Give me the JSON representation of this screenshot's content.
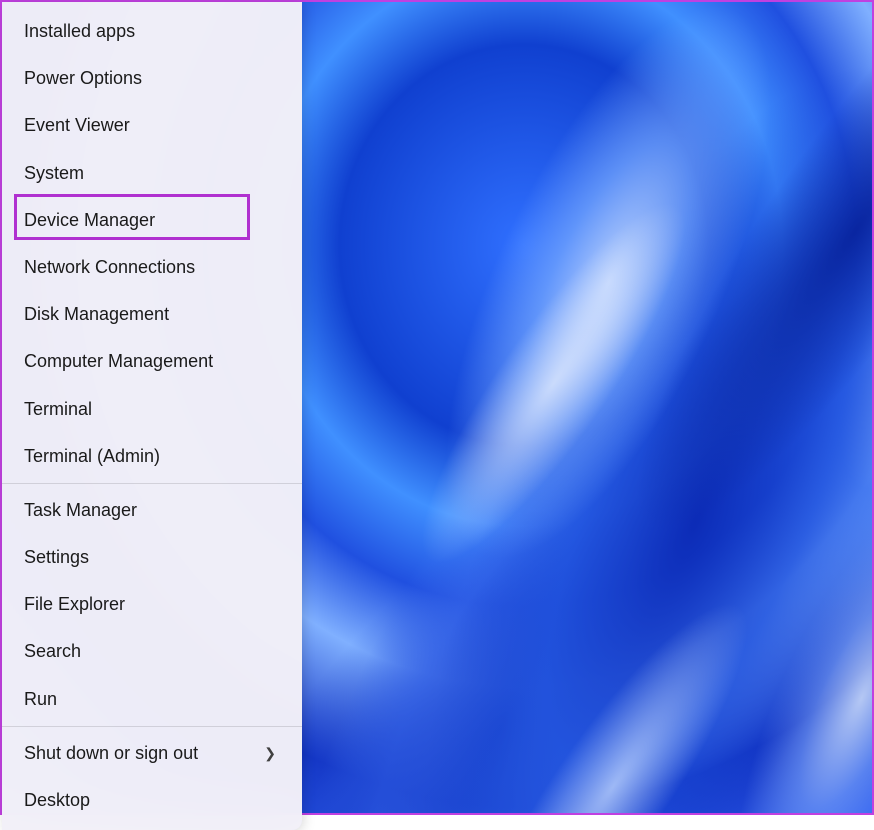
{
  "menu": {
    "groups": [
      {
        "items": [
          {
            "id": "installed-apps",
            "label": "Installed apps",
            "has_submenu": false
          },
          {
            "id": "power-options",
            "label": "Power Options",
            "has_submenu": false
          },
          {
            "id": "event-viewer",
            "label": "Event Viewer",
            "has_submenu": false
          },
          {
            "id": "system",
            "label": "System",
            "has_submenu": false
          },
          {
            "id": "device-manager",
            "label": "Device Manager",
            "has_submenu": false,
            "highlighted": true
          },
          {
            "id": "network-connections",
            "label": "Network Connections",
            "has_submenu": false
          },
          {
            "id": "disk-management",
            "label": "Disk Management",
            "has_submenu": false
          },
          {
            "id": "computer-management",
            "label": "Computer Management",
            "has_submenu": false
          },
          {
            "id": "terminal",
            "label": "Terminal",
            "has_submenu": false
          },
          {
            "id": "terminal-admin",
            "label": "Terminal (Admin)",
            "has_submenu": false
          }
        ]
      },
      {
        "items": [
          {
            "id": "task-manager",
            "label": "Task Manager",
            "has_submenu": false
          },
          {
            "id": "settings",
            "label": "Settings",
            "has_submenu": false
          },
          {
            "id": "file-explorer",
            "label": "File Explorer",
            "has_submenu": false
          },
          {
            "id": "search",
            "label": "Search",
            "has_submenu": false
          },
          {
            "id": "run",
            "label": "Run",
            "has_submenu": false
          }
        ]
      },
      {
        "items": [
          {
            "id": "shut-down-sign-out",
            "label": "Shut down or sign out",
            "has_submenu": true
          },
          {
            "id": "desktop",
            "label": "Desktop",
            "has_submenu": false
          }
        ]
      }
    ]
  },
  "highlight": {
    "target_id": "device-manager",
    "color": "#b030d0"
  }
}
